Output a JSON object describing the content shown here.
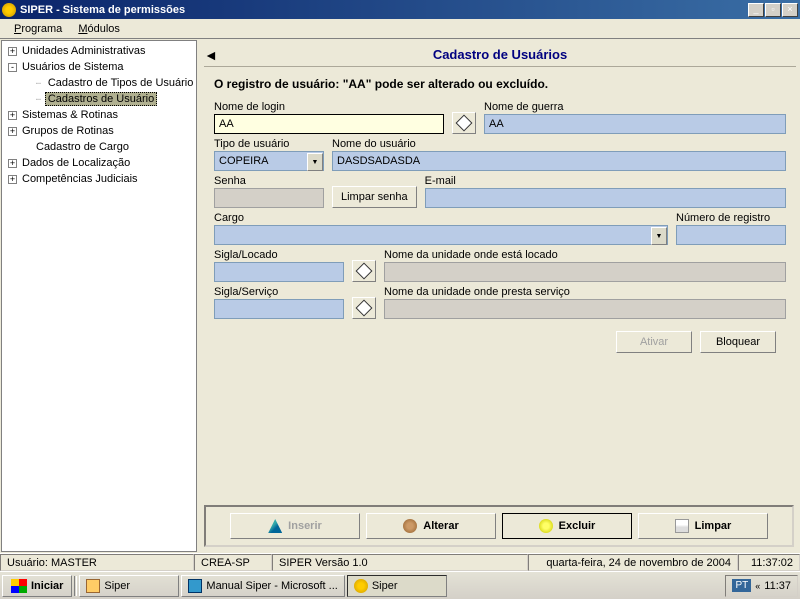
{
  "titlebar": {
    "title": "SIPER - Sistema de permissões"
  },
  "menubar": {
    "items": [
      "Programa",
      "Módulos"
    ]
  },
  "tree": {
    "items": [
      {
        "toggle": "+",
        "label": "Unidades Administrativas",
        "indent": 0
      },
      {
        "toggle": "-",
        "label": "Usuários de Sistema",
        "indent": 0
      },
      {
        "toggle": "",
        "label": "Cadastro de Tipos de Usuário",
        "indent": 2
      },
      {
        "toggle": "",
        "label": "Cadastros de Usuário",
        "indent": 2,
        "selected": true
      },
      {
        "toggle": "+",
        "label": "Sistemas & Rotinas",
        "indent": 0
      },
      {
        "toggle": "+",
        "label": "Grupos de Rotinas",
        "indent": 0
      },
      {
        "toggle": "",
        "label": "Cadastro de Cargo",
        "indent": 1
      },
      {
        "toggle": "+",
        "label": "Dados de Localização",
        "indent": 0
      },
      {
        "toggle": "+",
        "label": "Competências Judiciais",
        "indent": 0
      }
    ]
  },
  "content": {
    "title": "Cadastro de Usuários",
    "subtitle": "O registro de usuário: \"AA\" pode ser alterado ou excluído.",
    "labels": {
      "nome_login": "Nome de login",
      "nome_guerra": "Nome de guerra",
      "tipo_usuario": "Tipo de usuário",
      "nome_usuario": "Nome do usuário",
      "senha": "Senha",
      "limpar_senha": "Limpar senha",
      "email": "E-mail",
      "cargo": "Cargo",
      "numero_registro": "Número de registro",
      "sigla_locado": "Sigla/Locado",
      "nome_unidade_locado": "Nome da unidade onde está locado",
      "sigla_servico": "Sigla/Serviço",
      "nome_unidade_servico": "Nome da unidade onde presta serviço"
    },
    "values": {
      "nome_login": "AA",
      "nome_guerra": "AA",
      "tipo_usuario": "COPEIRA",
      "nome_usuario": "DASDSADASDA",
      "senha": "",
      "email": "",
      "cargo": "",
      "numero_registro": "",
      "sigla_locado": "",
      "nome_unidade_locado": "",
      "sigla_servico": "",
      "nome_unidade_servico": ""
    },
    "buttons": {
      "ativar": "Ativar",
      "bloquear": "Bloquear"
    },
    "footer_buttons": {
      "inserir": "Inserir",
      "alterar": "Alterar",
      "excluir": "Excluir",
      "limpar": "Limpar"
    }
  },
  "statusbar": {
    "user": "Usuário: MASTER",
    "org": "CREA-SP",
    "version": "SIPER Versão 1.0",
    "date": "quarta-feira, 24 de novembro de 2004",
    "time": "11:37:02"
  },
  "taskbar": {
    "start": "Iniciar",
    "items": [
      {
        "label": "Siper",
        "icon": "folder"
      },
      {
        "label": "Manual Siper - Microsoft ...",
        "icon": "word"
      },
      {
        "label": "Siper",
        "icon": "app",
        "pressed": true
      }
    ],
    "tray": {
      "lang": "PT",
      "time": "11:37"
    }
  }
}
